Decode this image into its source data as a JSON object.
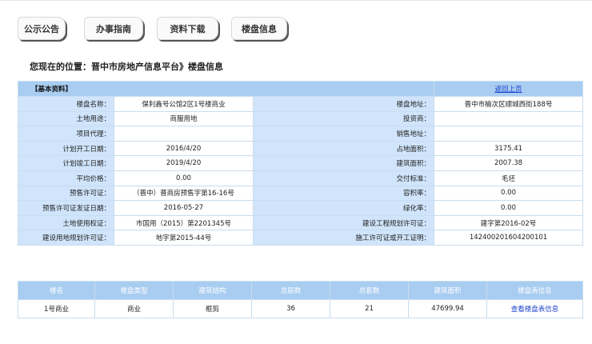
{
  "tabs": [
    {
      "label": "公示公告"
    },
    {
      "label": "办事指南"
    },
    {
      "label": "资料下载"
    },
    {
      "label": "楼盘信息"
    }
  ],
  "breadcrumb": "您现在的位置：晋中市房地产信息平台》楼盘信息",
  "basic_info": {
    "title": "【基本资料】",
    "return_link": "返回上页",
    "rows": [
      {
        "l1": "楼盘名称：",
        "v1": "保利鑫号公馆2区1号楼商业",
        "l2": "楼盘地址：",
        "v2": "晋中市榆次区顺城西街188号"
      },
      {
        "l1": "土地用途：",
        "v1": "商服用地",
        "l2": "投资商：",
        "v2": ""
      },
      {
        "l1": "项目代理：",
        "v1": "",
        "l2": "销售地址：",
        "v2": ""
      },
      {
        "l1": "计划开工日期：",
        "v1": "2016/4/20",
        "l2": "占地面积：",
        "v2": "3175.41"
      },
      {
        "l1": "计划竣工日期：",
        "v1": "2019/4/20",
        "l2": "建筑面积：",
        "v2": "2007.38"
      },
      {
        "l1": "平均价格：",
        "v1": "0.00",
        "l2": "交付标准：",
        "v2": "毛坯"
      },
      {
        "l1": "预售许可证：",
        "v1": "（晋中）晋商房预售字第16-16号",
        "l2": "容积率：",
        "v2": "0.00"
      },
      {
        "l1": "预售许可证发证日期：",
        "v1": "2016-05-27",
        "l2": "绿化率：",
        "v2": "0.00"
      },
      {
        "l1": "土地使用权证：",
        "v1": "市国用（2015）第2201345号",
        "l2": "建设工程规划许可证：",
        "v2": "建字第2016-02号"
      },
      {
        "l1": "建设用地规划许可证：",
        "v1": "地字第2015-44号",
        "l2": "施工许可证或开工证明：",
        "v2": "142400201604200101"
      }
    ]
  },
  "buildings": {
    "headers": [
      "楼名",
      "楼盘类型",
      "建筑结构",
      "总层数",
      "总套数",
      "建筑面积",
      "楼盘表信息"
    ],
    "rows": [
      {
        "name": "1号商业",
        "type": "商业",
        "structure": "框剪",
        "floors": "36",
        "units": "21",
        "area": "47699.94",
        "link": "查看楼盘表信息"
      }
    ]
  }
}
